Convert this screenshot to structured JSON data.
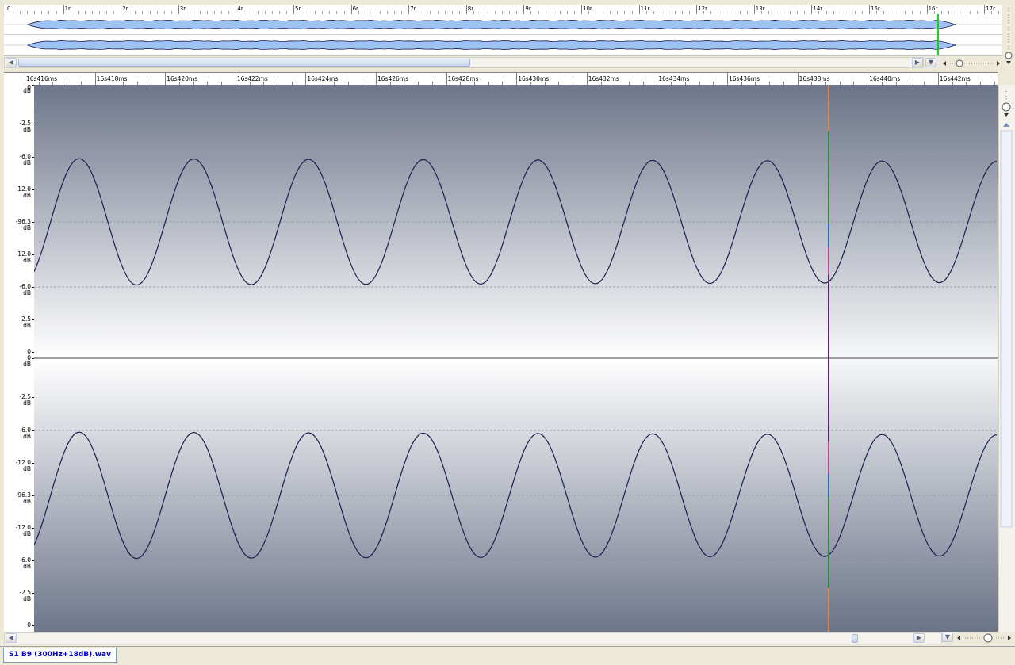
{
  "overview": {
    "ticks": [
      "0",
      "1r",
      "2r",
      "3r",
      "4r",
      "5r",
      "6r",
      "7r",
      "8r",
      "9r",
      "10r",
      "11r",
      "12r",
      "13r",
      "14r",
      "15r",
      "16r",
      "17r"
    ]
  },
  "main_ruler": {
    "labels": [
      "16s416ms",
      "16s418ms",
      "16s420ms",
      "16s422ms",
      "16s424ms",
      "16s426ms",
      "16s428ms",
      "16s430ms",
      "16s432ms",
      "16s434ms",
      "16s436ms",
      "16s438ms",
      "16s440ms",
      "16s442ms"
    ]
  },
  "db_scale": {
    "channel1": [
      "0",
      "dB",
      "-2.5",
      "dB",
      "-6.0",
      "dB",
      "-12.0",
      "dB",
      "-96.3",
      "dB",
      "-12.0",
      "dB",
      "-6.0",
      "dB",
      "-2.5",
      "dB",
      "0"
    ],
    "channel2": [
      "0",
      "dB",
      "-2.5",
      "dB",
      "-6.0",
      "dB",
      "-12.0",
      "dB",
      "-96.3",
      "dB",
      "-12.0",
      "dB",
      "-6.0",
      "dB",
      "-2.5",
      "dB",
      "0"
    ]
  },
  "waveform": {
    "frequency_hz": 300,
    "cycles_visible": 8.4,
    "wave_color": "#1c1f4f",
    "background_top": "#6e768b",
    "background_bottom": "#ffffff",
    "cursor_colors": [
      "#e8833a",
      "#2f8a2f",
      "#2a62b8",
      "#c04090",
      "#5a2a6a"
    ]
  },
  "tab": {
    "label": "S1 B9 (300Hz+18dB).wav"
  },
  "colors": {
    "overview_wave": "#9ec3f2",
    "overview_wave_edge": "#1c1f4f",
    "playhead": "#22cc22"
  }
}
